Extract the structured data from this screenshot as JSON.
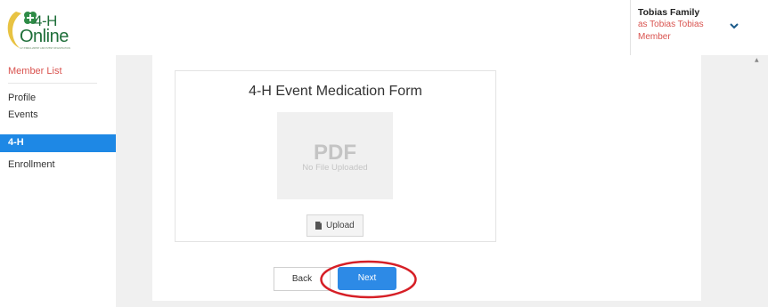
{
  "header": {
    "logo_line1": "4-H",
    "logo_line2": "Online",
    "logo_tagline": "4-H ENROLLMENT AND EVENT REGISTRATION",
    "user_name": "Tobias Family",
    "user_as": "as Tobias Tobias",
    "user_role": "Member"
  },
  "sidebar": {
    "items": [
      {
        "label": "Member List"
      },
      {
        "label": "Profile"
      },
      {
        "label": "Events"
      },
      {
        "label": "4-H"
      },
      {
        "label": "Enrollment"
      }
    ]
  },
  "form": {
    "title": "4-H Event Medication Form",
    "pdf_label": "PDF",
    "no_file": "No File Uploaded",
    "upload_label": "Upload"
  },
  "buttons": {
    "back": "Back",
    "next": "Next"
  },
  "colors": {
    "accent": "#1e88e5",
    "next": "#2d8ae6",
    "alert": "#d9534f",
    "brand": "#1f6f3a",
    "highlight": "#d61f26"
  },
  "icons": {
    "logo": "clover-logo-icon",
    "dropdown": "chevron-down-icon",
    "upload": "file-icon",
    "scroll": "scroll-up-arrow-icon"
  }
}
